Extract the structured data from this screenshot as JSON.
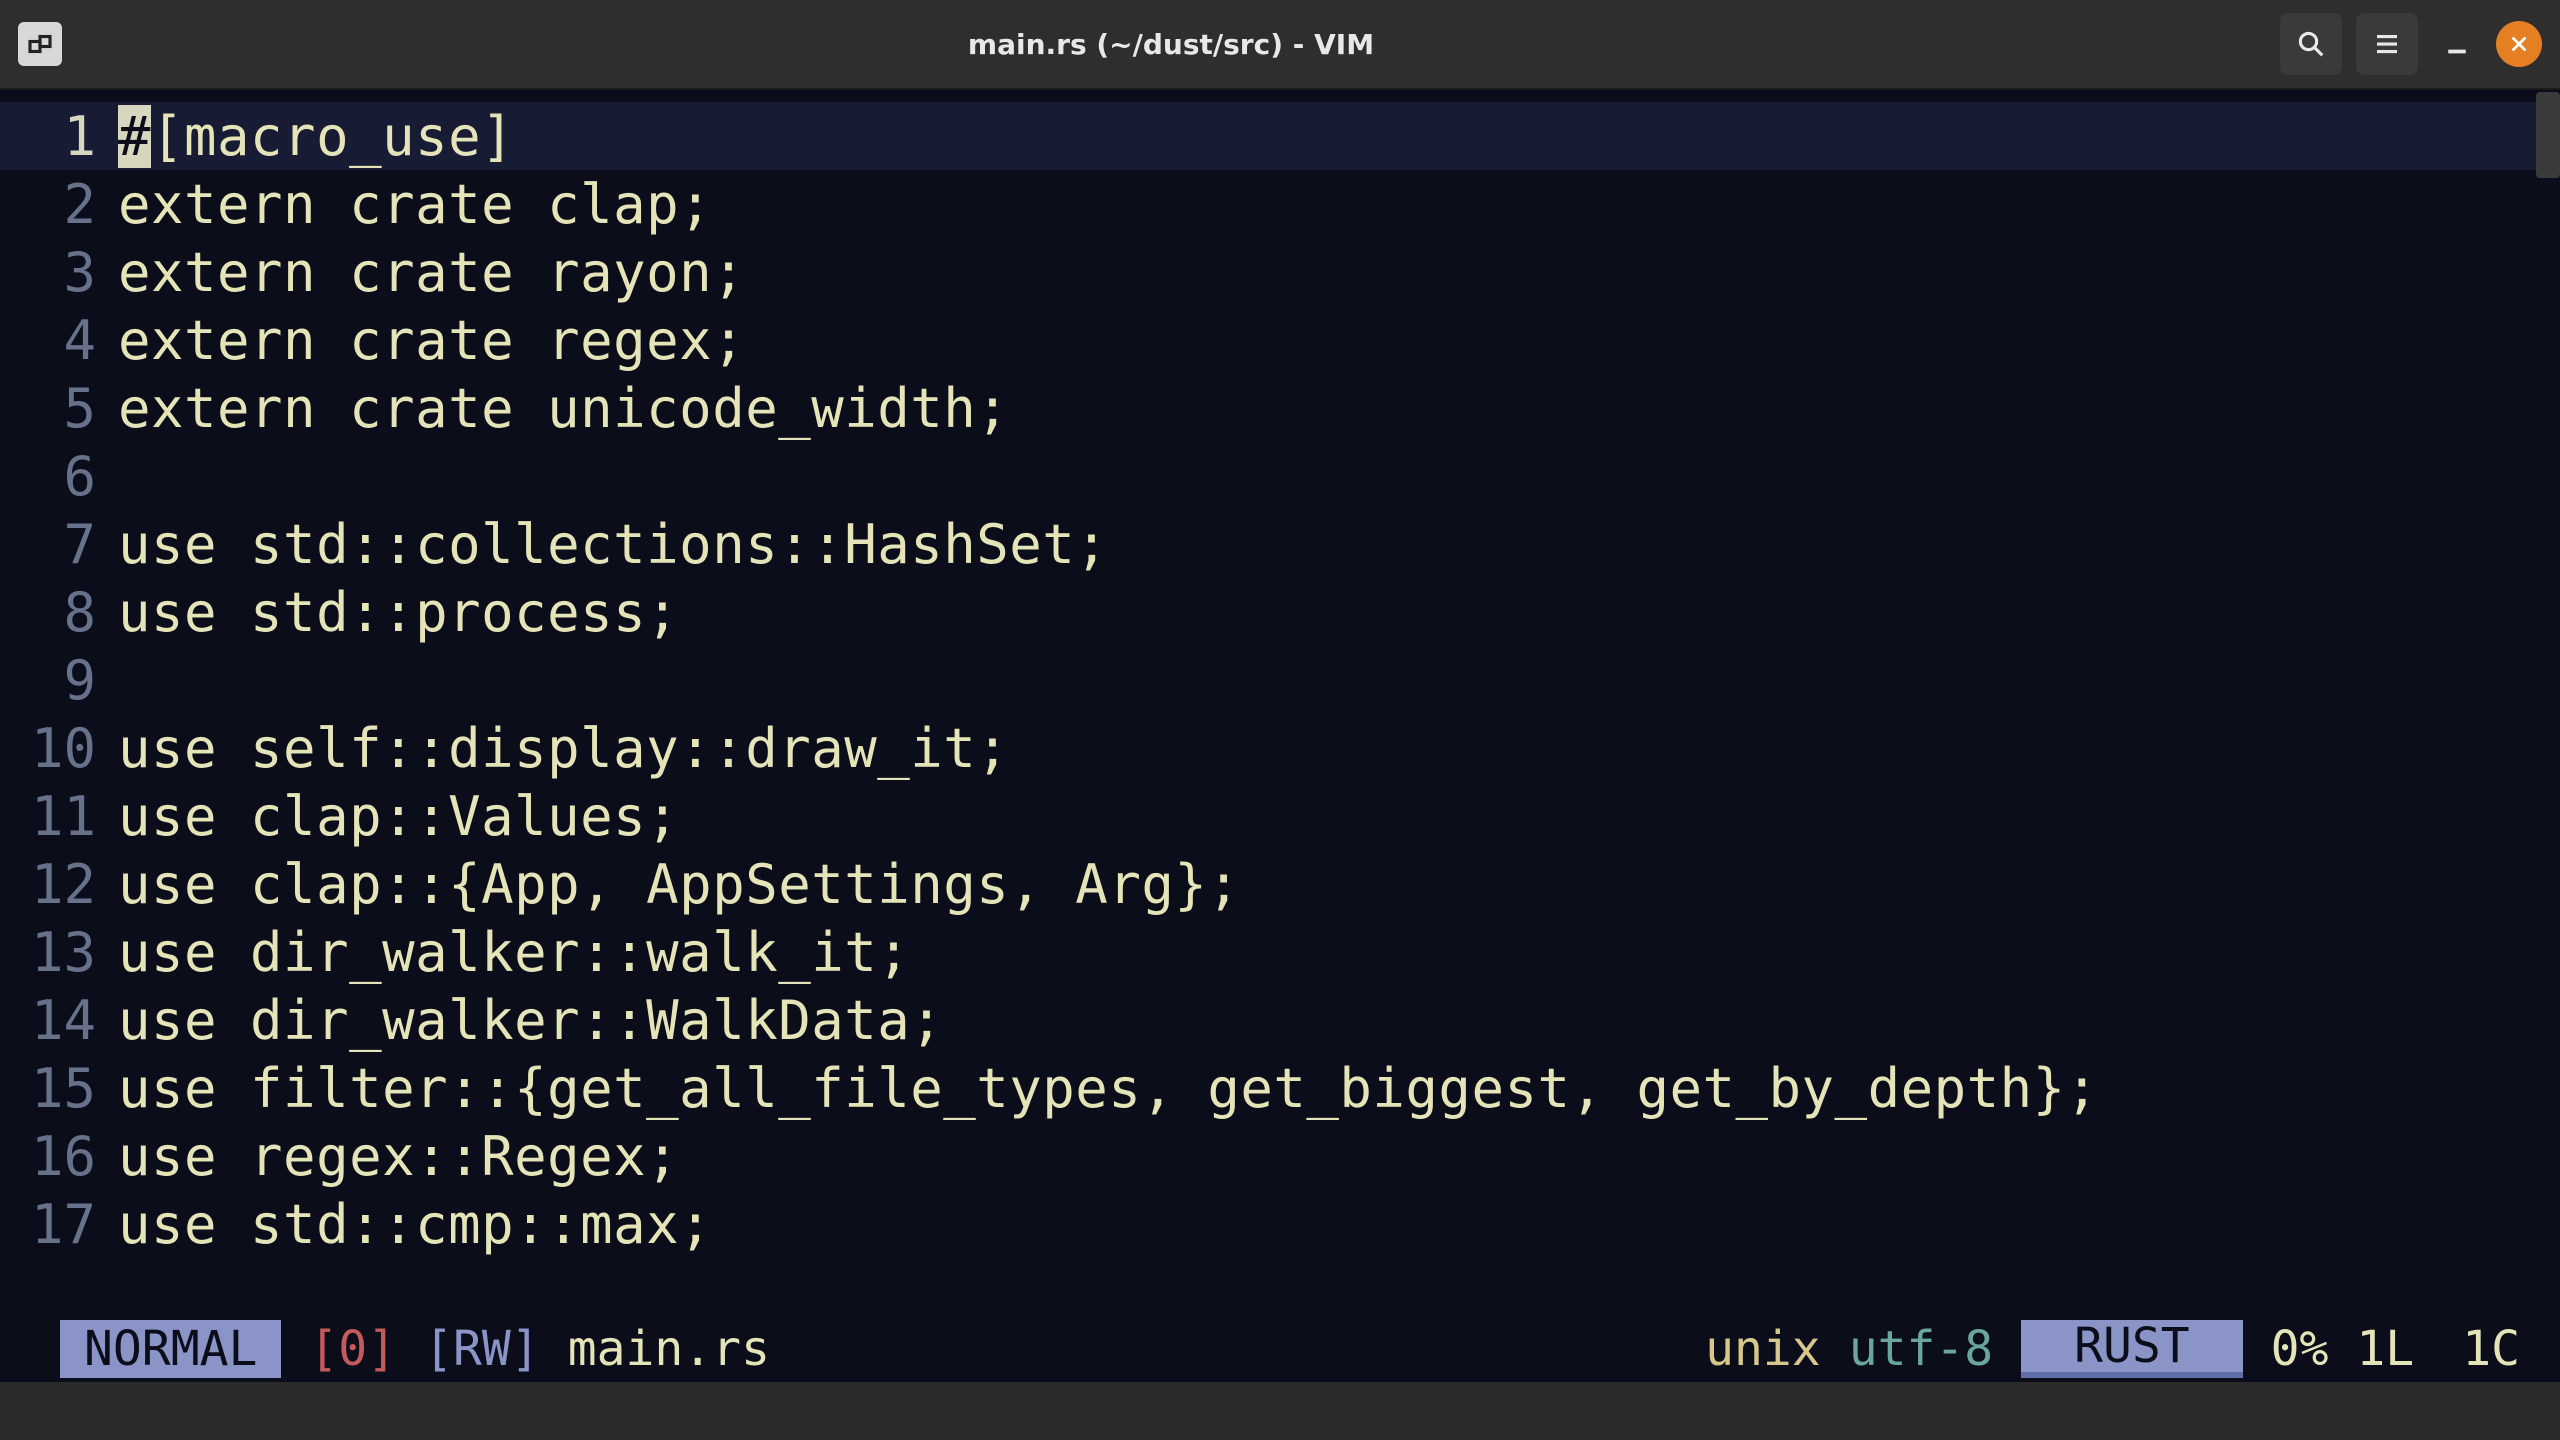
{
  "titlebar": {
    "title": "main.rs (~/dust/src) - VIM"
  },
  "cursor": {
    "line": 1,
    "col": 1
  },
  "code_lines": [
    "#[macro_use]",
    "extern crate clap;",
    "extern crate rayon;",
    "extern crate regex;",
    "extern crate unicode_width;",
    "",
    "use std::collections::HashSet;",
    "use std::process;",
    "",
    "use self::display::draw_it;",
    "use clap::Values;",
    "use clap::{App, AppSettings, Arg};",
    "use dir_walker::walk_it;",
    "use dir_walker::WalkData;",
    "use filter::{get_all_file_types, get_biggest, get_by_depth};",
    "use regex::Regex;",
    "use std::cmp::max;"
  ],
  "status": {
    "mode": "NORMAL",
    "num": "[0]",
    "rw": "[RW]",
    "filename": "main.rs",
    "fileformat": "unix",
    "encoding": "utf-8",
    "filetype": "RUST",
    "percent": "0%",
    "line_pos": "1L",
    "col_pos": "1C"
  }
}
